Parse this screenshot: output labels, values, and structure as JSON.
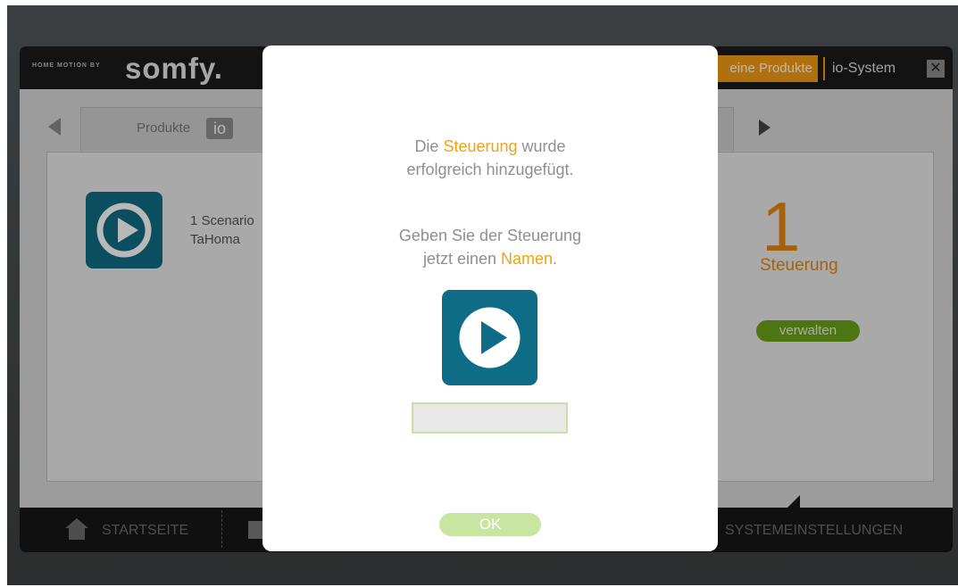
{
  "header": {
    "tagline": "HOME MOTION BY",
    "brand": "somfy.",
    "nav_active": "eine Produkte",
    "nav_item": "io-System",
    "close": "✕"
  },
  "tabs": {
    "active_label": "Produkte",
    "badge": "io"
  },
  "panel": {
    "scenario_line1": "1 Scenario",
    "scenario_line2": "TaHoma",
    "count": "1",
    "count_label": "Steuerung",
    "manage_button": "verwalten"
  },
  "bottom_nav": {
    "home": "STARTSEITE",
    "settings": "SYSTEMEINSTELLUNGEN"
  },
  "modal": {
    "msg1_prefix": "Die ",
    "msg1_highlight": "Steuerung",
    "msg1_suffix": " wurde",
    "msg1_line2": "erfolgreich hinzugefügt.",
    "msg2_line1": "Geben Sie der Steuerung",
    "msg2_prefix": "jetzt einen ",
    "msg2_highlight": "Namen",
    "msg2_suffix": ".",
    "input_value": "",
    "ok_button": "OK"
  },
  "colors": {
    "accent": "#f0a30a",
    "icon_bg": "#0f6c86",
    "manage_green": "#6ba31a"
  }
}
